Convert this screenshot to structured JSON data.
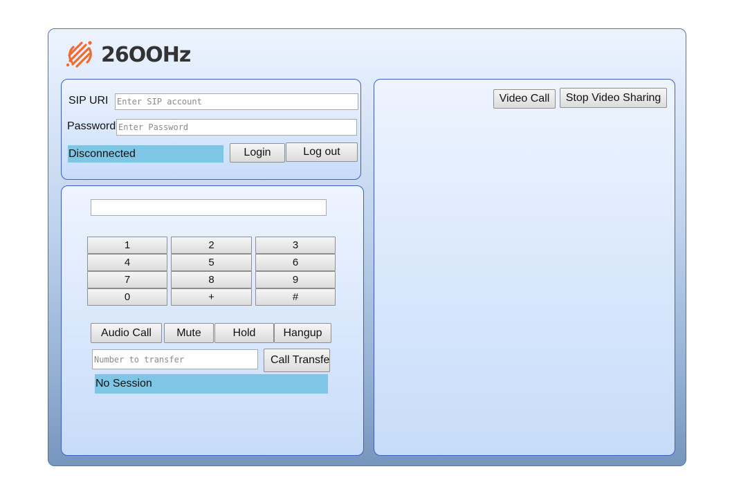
{
  "brand": {
    "name": "26OOHz",
    "logo_color": "#f26a2e"
  },
  "login": {
    "sip_label": "SIP URI",
    "sip_placeholder": "Enter SIP account",
    "password_label": "Password",
    "password_placeholder": "Enter Password",
    "status": "Disconnected",
    "login_button": "Login",
    "logout_button": "Log out"
  },
  "dialer": {
    "number_value": "",
    "keys": [
      "1",
      "2",
      "3",
      "4",
      "5",
      "6",
      "7",
      "8",
      "9",
      "0",
      "+",
      "#"
    ],
    "audio_call": "Audio Call",
    "mute": "Mute",
    "hold": "Hold",
    "hangup": "Hangup",
    "transfer_placeholder": "Number to transfer",
    "call_transfer": "Call Transfe",
    "session_status": "No Session"
  },
  "video": {
    "video_call": "Video Call",
    "stop_video_sharing": "Stop Video Sharing"
  },
  "colors": {
    "status_bar": "#7ec5e6",
    "panel_border": "#3d5fc4",
    "app_border": "#4a73b5"
  }
}
